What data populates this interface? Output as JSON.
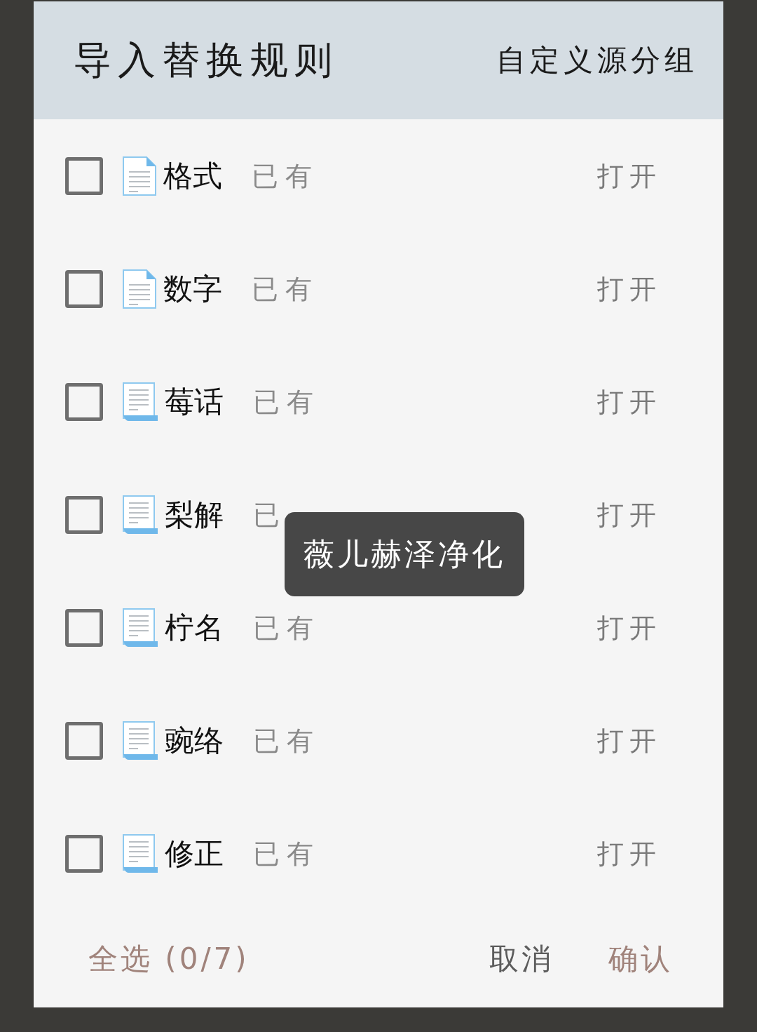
{
  "dialog": {
    "title": "导入替换规则",
    "action": "自定义源分组"
  },
  "rows": [
    {
      "kind": "page",
      "checked": false,
      "name": "格式",
      "status": "已有",
      "open": "打开"
    },
    {
      "kind": "page",
      "checked": false,
      "name": "数字",
      "status": "已有",
      "open": "打开"
    },
    {
      "kind": "scroll",
      "checked": false,
      "name": "莓话",
      "status": "已有",
      "open": "打开"
    },
    {
      "kind": "scroll",
      "checked": false,
      "name": "梨解",
      "status": "已",
      "open": "打开"
    },
    {
      "kind": "scroll",
      "checked": false,
      "name": "柠名",
      "status": "已有",
      "open": "打开"
    },
    {
      "kind": "scroll",
      "checked": false,
      "name": "豌络",
      "status": "已有",
      "open": "打开"
    },
    {
      "kind": "scroll",
      "checked": false,
      "name": "修正",
      "status": "已有",
      "open": "打开"
    }
  ],
  "toast": {
    "text": "薇儿赫泽净化"
  },
  "footer": {
    "select_all": "全选 (0/7)",
    "cancel": "取消",
    "confirm": "确认"
  }
}
